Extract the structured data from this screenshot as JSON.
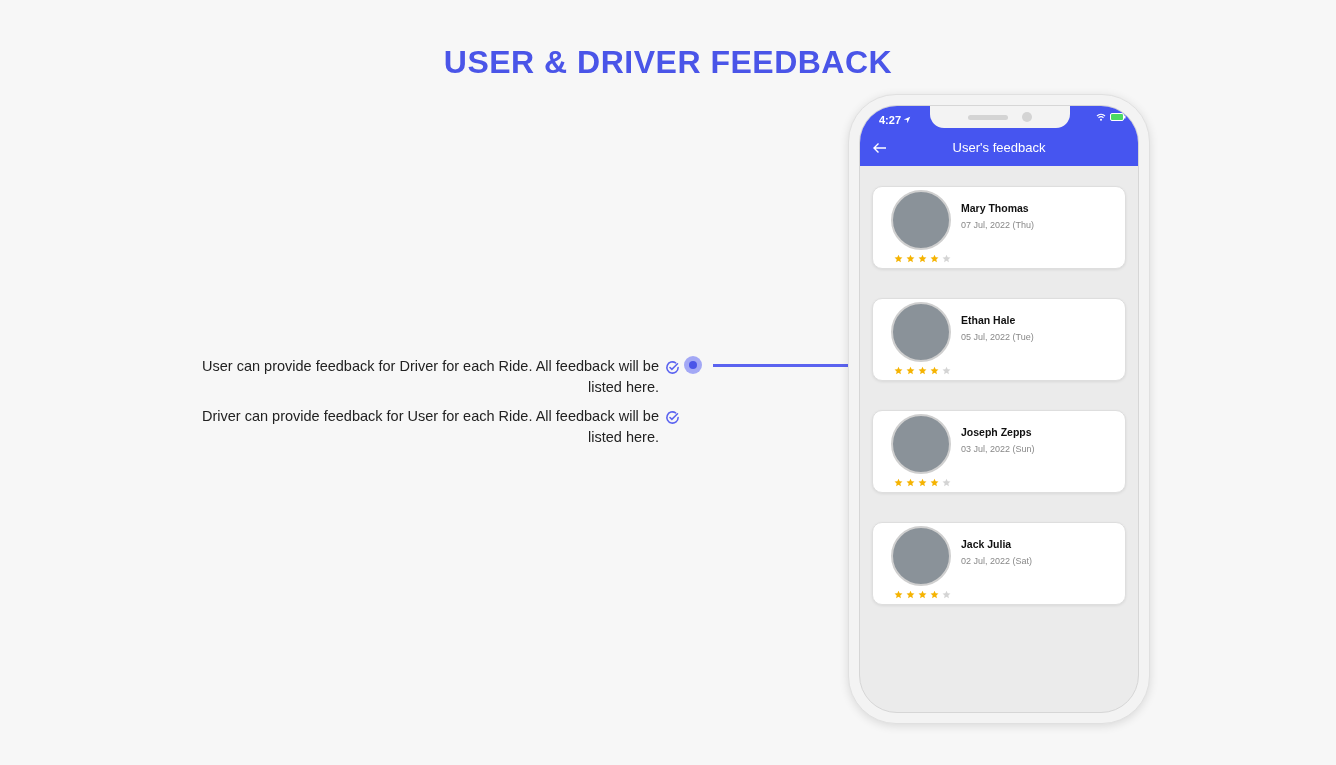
{
  "title": "USER & DRIVER FEEDBACK",
  "features": [
    {
      "text": "User can provide feedback for Driver for each Ride. All feedback will be listed here."
    },
    {
      "text": "Driver can provide feedback for User for each Ride. All feedback will be listed here."
    }
  ],
  "phone": {
    "status_time": "4:27",
    "screen_title": "User's feedback",
    "feedback": [
      {
        "name": "Mary Thomas",
        "date": "07 Jul, 2022 (Thu)",
        "stars": 4
      },
      {
        "name": "Ethan Hale",
        "date": "05 Jul, 2022 (Tue)",
        "stars": 4
      },
      {
        "name": "Joseph Zepps",
        "date": "03 Jul, 2022 (Sun)",
        "stars": 4
      },
      {
        "name": "Jack Julia",
        "date": "02 Jul, 2022 (Sat)",
        "stars": 4
      }
    ]
  }
}
